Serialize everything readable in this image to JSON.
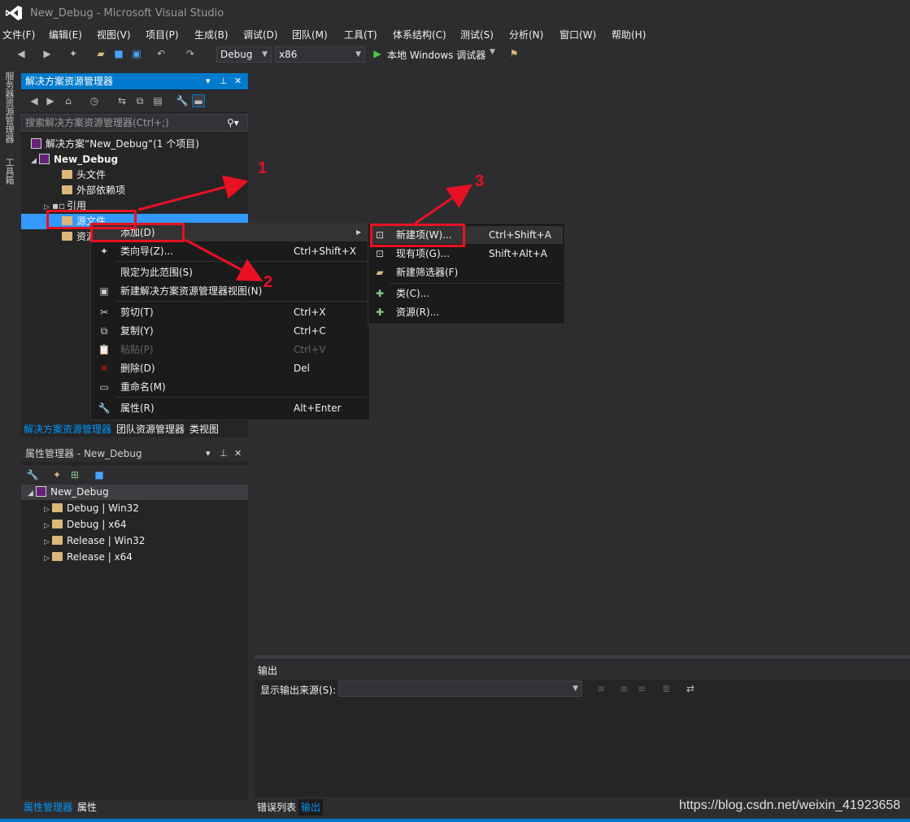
{
  "window": {
    "title": "New_Debug - Microsoft Visual Studio"
  },
  "menu": [
    "文件(F)",
    "编辑(E)",
    "视图(V)",
    "项目(P)",
    "生成(B)",
    "调试(D)",
    "团队(M)",
    "工具(T)",
    "体系结构(C)",
    "测试(S)",
    "分析(N)",
    "窗口(W)",
    "帮助(H)"
  ],
  "toolbar": {
    "config": "Debug",
    "platform": "x86",
    "run_label": "本地 Windows 调试器"
  },
  "left_strip": {
    "server_explorer": "服务器资源管理器",
    "toolbox": "工具箱"
  },
  "solution_explorer": {
    "title": "解决方案资源管理器",
    "search_placeholder": "搜索解决方案资源管理器(Ctrl+;)",
    "solution": "解决方案“New_Debug”(1 个项目)",
    "project": "New_Debug",
    "items": [
      "头文件",
      "外部依赖项",
      "引用",
      "源文件",
      "资源文件"
    ]
  },
  "se_tabs": [
    "解决方案资源管理器",
    "团队资源管理器",
    "类视图"
  ],
  "property_manager": {
    "title": "属性管理器 - New_Debug",
    "project": "New_Debug",
    "configs": [
      "Debug | Win32",
      "Debug | x64",
      "Release | Win32",
      "Release | x64"
    ]
  },
  "pm_tabs": [
    "属性管理器",
    "属性"
  ],
  "context_menu": {
    "items": [
      {
        "label": "添加(D)",
        "shortcut": "",
        "icon": "",
        "submenu": true
      },
      {
        "label": "类向导(Z)...",
        "shortcut": "Ctrl+Shift+X",
        "icon": "✦"
      },
      {
        "label": "限定为此范围(S)",
        "shortcut": "",
        "icon": ""
      },
      {
        "label": "新建解决方案资源管理器视图(N)",
        "shortcut": "",
        "icon": "▣"
      },
      {
        "label": "剪切(T)",
        "shortcut": "Ctrl+X",
        "icon": "✂"
      },
      {
        "label": "复制(Y)",
        "shortcut": "Ctrl+C",
        "icon": "⧉"
      },
      {
        "label": "粘贴(P)",
        "shortcut": "Ctrl+V",
        "icon": "📋"
      },
      {
        "label": "删除(D)",
        "shortcut": "Del",
        "icon": "✕"
      },
      {
        "label": "重命名(M)",
        "shortcut": "",
        "icon": "▭"
      },
      {
        "label": "属性(R)",
        "shortcut": "Alt+Enter",
        "icon": "🔧"
      }
    ]
  },
  "submenu": {
    "items": [
      {
        "label": "新建项(W)...",
        "shortcut": "Ctrl+Shift+A"
      },
      {
        "label": "现有项(G)...",
        "shortcut": "Shift+Alt+A"
      },
      {
        "label": "新建筛选器(F)",
        "shortcut": ""
      },
      {
        "label": "类(C)...",
        "shortcut": ""
      },
      {
        "label": "资源(R)...",
        "shortcut": ""
      }
    ]
  },
  "output": {
    "title": "输出",
    "source_label": "显示输出来源(S):"
  },
  "output_tabs": [
    "错误列表",
    "输出"
  ],
  "annotations": [
    "1",
    "2",
    "3"
  ],
  "watermark": "https://blog.csdn.net/weixin_41923658",
  "colors": {
    "accent": "#007acc",
    "highlight": "#e81123",
    "selection": "#3399ff"
  }
}
